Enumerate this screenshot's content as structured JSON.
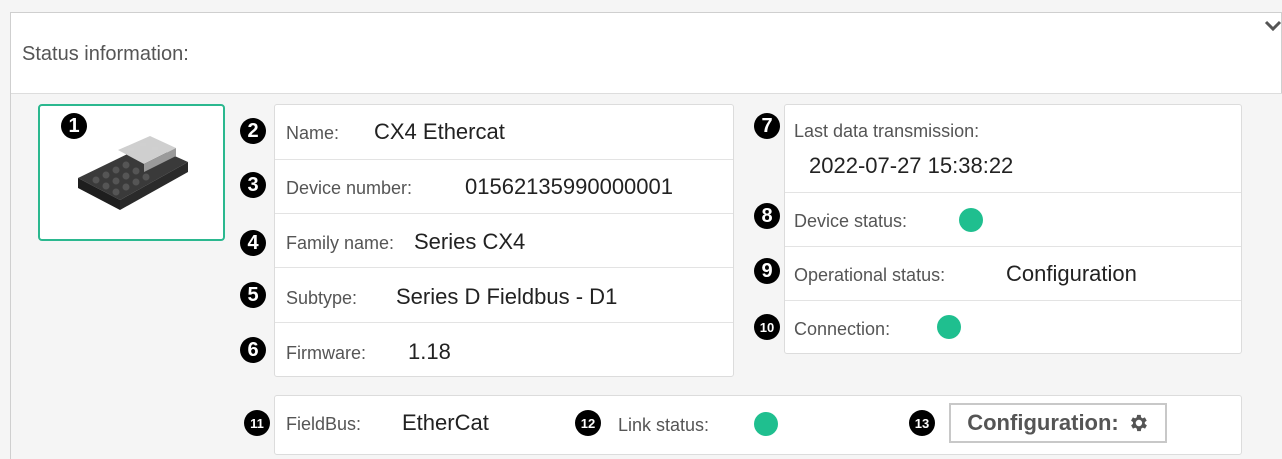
{
  "panel": {
    "title": "Status information:"
  },
  "markers": [
    "1",
    "2",
    "3",
    "4",
    "5",
    "6",
    "7",
    "8",
    "9",
    "10",
    "11",
    "12",
    "13"
  ],
  "device": {
    "name_label": "Name:",
    "name_value": "CX4 Ethercat",
    "number_label": "Device number:",
    "number_value": "01562135990000001",
    "family_label": "Family name:",
    "family_value": "Series CX4",
    "subtype_label": "Subtype:",
    "subtype_value": "Series D Fieldbus - D1",
    "firmware_label": "Firmware:",
    "firmware_value": "1.18"
  },
  "status": {
    "last_tx_label": "Last data transmission:",
    "last_tx_value": "2022-07-27 15:38:22",
    "device_status_label": "Device status:",
    "operational_label": "Operational status:",
    "operational_value": "Configuration",
    "connection_label": "Connection:"
  },
  "fieldbus": {
    "label": "FieldBus:",
    "value": "EtherCat",
    "link_label": "Link status:",
    "config_button": "Configuration:"
  },
  "colors": {
    "status_ok": "#1fbf8f",
    "accent_border": "#2bb88f"
  },
  "icons": {
    "collapse": "chevron-down-icon",
    "config": "gear-icon"
  }
}
